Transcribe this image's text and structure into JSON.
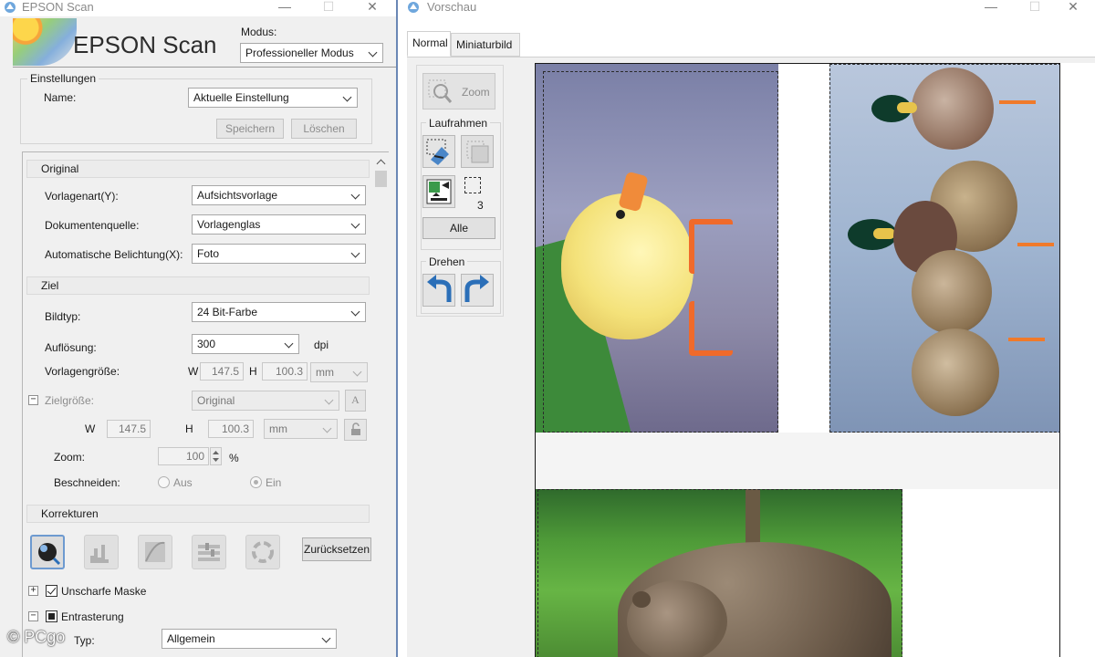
{
  "left_window": {
    "title": "EPSON Scan",
    "logo_text": "EPSON Scan",
    "modus_label": "Modus:",
    "modus_value": "Professioneller Modus",
    "einstellungen": {
      "title": "Einstellungen",
      "name_label": "Name:",
      "name_value": "Aktuelle Einstellung",
      "save_label": "Speichern",
      "delete_label": "Löschen"
    },
    "original": {
      "title": "Original",
      "vorlagenart_label": "Vorlagenart(Y):",
      "vorlagenart_value": "Aufsichtsvorlage",
      "dokumentenquelle_label": "Dokumentenquelle:",
      "dokumentenquelle_value": "Vorlagenglas",
      "belichtung_label": "Automatische Belichtung(X):",
      "belichtung_value": "Foto"
    },
    "ziel": {
      "title": "Ziel",
      "bildtyp_label": "Bildtyp:",
      "bildtyp_value": "24 Bit-Farbe",
      "aufloesung_label": "Auflösung:",
      "aufloesung_value": "300",
      "dpi_label": "dpi",
      "vorlagengroesse_label": "Vorlagengröße:",
      "w_label": "W",
      "h_label": "H",
      "vorlage_w": "147.5",
      "vorlage_h": "100.3",
      "unit_value": "mm",
      "zielgroesse_label": "Zielgröße:",
      "zielgroesse_value": "Original",
      "font_icon_label": "A",
      "ziel_w": "147.5",
      "ziel_h": "100.3",
      "ziel_unit": "mm",
      "zoom_label": "Zoom:",
      "zoom_value": "100",
      "zoom_unit": "%",
      "beschneiden_label": "Beschneiden:",
      "aus_label": "Aus",
      "ein_label": "Ein"
    },
    "korrekturen": {
      "title": "Korrekturen",
      "reset_label": "Zurücksetzen",
      "unscharfe_maske_label": "Unscharfe Maske",
      "entrasterung_label": "Entrasterung",
      "typ_label": "Typ:",
      "typ_value": "Allgemein"
    },
    "watermark": "© PCgo"
  },
  "right_window": {
    "title": "Vorschau",
    "tabs": [
      "Normal",
      "Miniaturbild"
    ],
    "zoom_label": "Zoom",
    "laufrahmen_title": "Laufrahmen",
    "frame_count": "3",
    "alle_label": "Alle",
    "drehen_title": "Drehen"
  },
  "colors": {
    "accent_blue": "#2b6fb8",
    "window_border": "#6a87b5",
    "panel_bg": "#f0f0f0"
  }
}
